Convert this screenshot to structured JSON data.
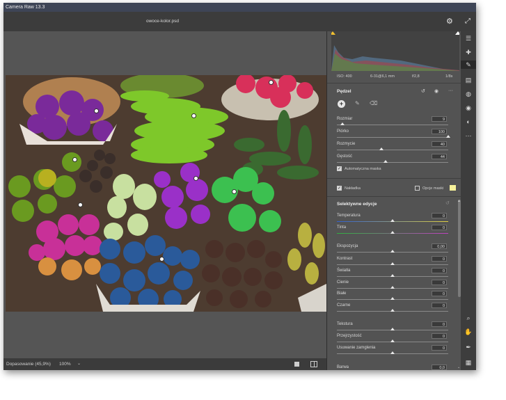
{
  "app": {
    "title": "Camera Raw 13.3",
    "filename": "owoce-kolor.psd"
  },
  "header_icons": [
    "gear-icon",
    "expand-icon"
  ],
  "status": {
    "fit": "Dopasowanie (45,9%)",
    "zoom": "100%",
    "zoom_chevron": "⌄"
  },
  "meta": {
    "iso": "ISO: 400",
    "lens": "6-31@6,1 mm",
    "aperture": "f/2,8",
    "shutter": "1/8s"
  },
  "brush_panel": {
    "title": "Pędzel",
    "icons": {
      "reset": "↺",
      "visibility": "◉",
      "more": "···"
    },
    "sliders": [
      {
        "label": "Rozmiar",
        "value": "9",
        "pos": 0.05
      },
      {
        "label": "Piórko",
        "value": "100",
        "pos": 1.0
      },
      {
        "label": "Rozmycie",
        "value": "40",
        "pos": 0.4
      },
      {
        "label": "Gęstość",
        "value": "44",
        "pos": 0.44
      }
    ],
    "automask": {
      "label": "Automatyczna maska",
      "checked": true
    },
    "overlay": {
      "label": "Nakładka",
      "checked": true
    },
    "mask_options": {
      "label": "Opcje maski",
      "checked": false,
      "color": "#f6f19a"
    }
  },
  "selective_edits": {
    "title": "Selektywne edycje",
    "sliders": [
      {
        "label": "Temperatura",
        "value": "0",
        "pos": 0.5,
        "track": "temperature"
      },
      {
        "label": "Tinta",
        "value": "0",
        "pos": 0.5,
        "track": "tint"
      },
      {
        "label": "Ekspozycja",
        "value": "0,00",
        "pos": 0.5,
        "track": "neutral"
      },
      {
        "label": "Kontrast",
        "value": "0",
        "pos": 0.5,
        "track": "neutral"
      },
      {
        "label": "Światła",
        "value": "0",
        "pos": 0.5,
        "track": "neutral"
      },
      {
        "label": "Cienie",
        "value": "0",
        "pos": 0.5,
        "track": "neutral"
      },
      {
        "label": "Białe",
        "value": "0",
        "pos": 0.5,
        "track": "neutral"
      },
      {
        "label": "Czarne",
        "value": "0",
        "pos": 0.5,
        "track": "neutral"
      },
      {
        "label": "Tekstura",
        "value": "0",
        "pos": 0.5,
        "track": "neutral"
      },
      {
        "label": "Przejrzystość",
        "value": "0",
        "pos": 0.5,
        "track": "neutral"
      },
      {
        "label": "Usuwanie zamglenia",
        "value": "0",
        "pos": 0.5,
        "track": "neutral"
      },
      {
        "label": "Barwa",
        "value": "0,0",
        "pos": 0.5,
        "track": "neutral"
      }
    ]
  },
  "colors": {
    "accent": "#ffffff",
    "panel_bg": "#535353",
    "title_bar": "#3e4556",
    "mask_overlay": "#f6f19a"
  }
}
